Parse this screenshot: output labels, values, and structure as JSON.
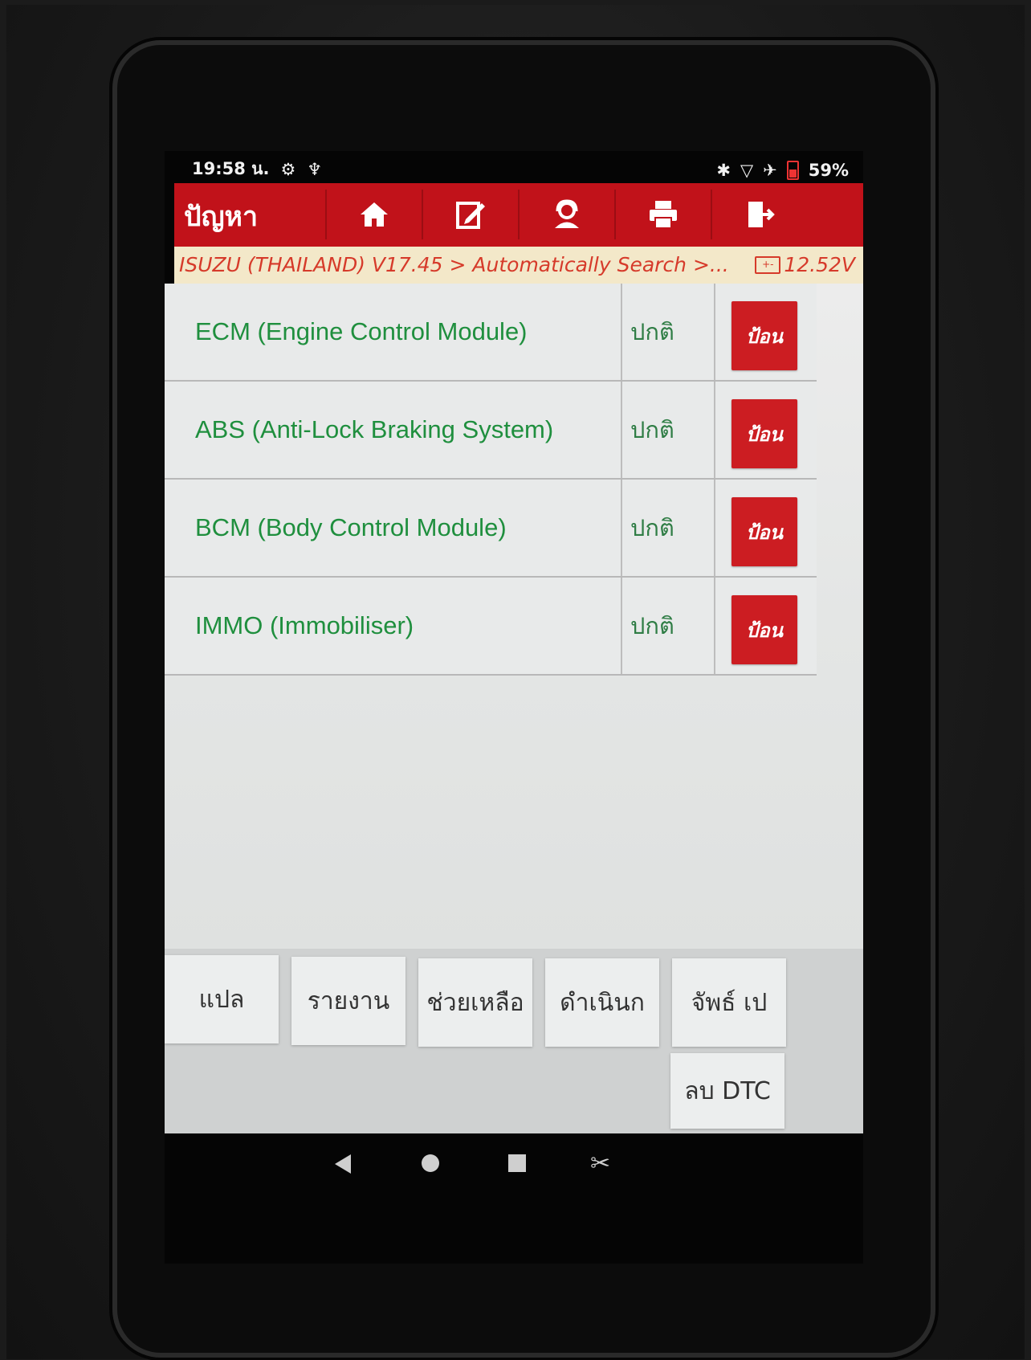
{
  "status_bar": {
    "time": "19:58 น.",
    "battery": "59%"
  },
  "app_bar": {
    "title": "ปัญหา"
  },
  "breadcrumb": {
    "path": "ISUZU (THAILAND) V17.45 > Automatically Search >...",
    "voltage": "12.52V"
  },
  "systems": [
    {
      "name": "ECM (Engine Control Module)",
      "status": "ปกติ",
      "enter_label": "ป้อน"
    },
    {
      "name": "ABS (Anti-Lock Braking System)",
      "status": "ปกติ",
      "enter_label": "ป้อน"
    },
    {
      "name": "BCM (Body Control Module)",
      "status": "ปกติ",
      "enter_label": "ป้อน"
    },
    {
      "name": "IMMO (Immobiliser)",
      "status": "ปกติ",
      "enter_label": "ป้อน"
    }
  ],
  "function_buttons": {
    "translate": "แปล",
    "report": "รายงาน",
    "help": "ช่วยเหลือ",
    "proceed": "ดำเนินก",
    "print": "จัพธ์ เป",
    "clear_dtc": "ลบ DTC"
  },
  "colors": {
    "header_red": "#c1121a",
    "system_green": "#1f8f3e",
    "breadcrumb_bg": "#f3e8c9",
    "breadcrumb_text": "#d63a2a"
  },
  "icons": [
    "home-icon",
    "edit-report-icon",
    "support-agent-icon",
    "print-icon",
    "exit-icon"
  ]
}
